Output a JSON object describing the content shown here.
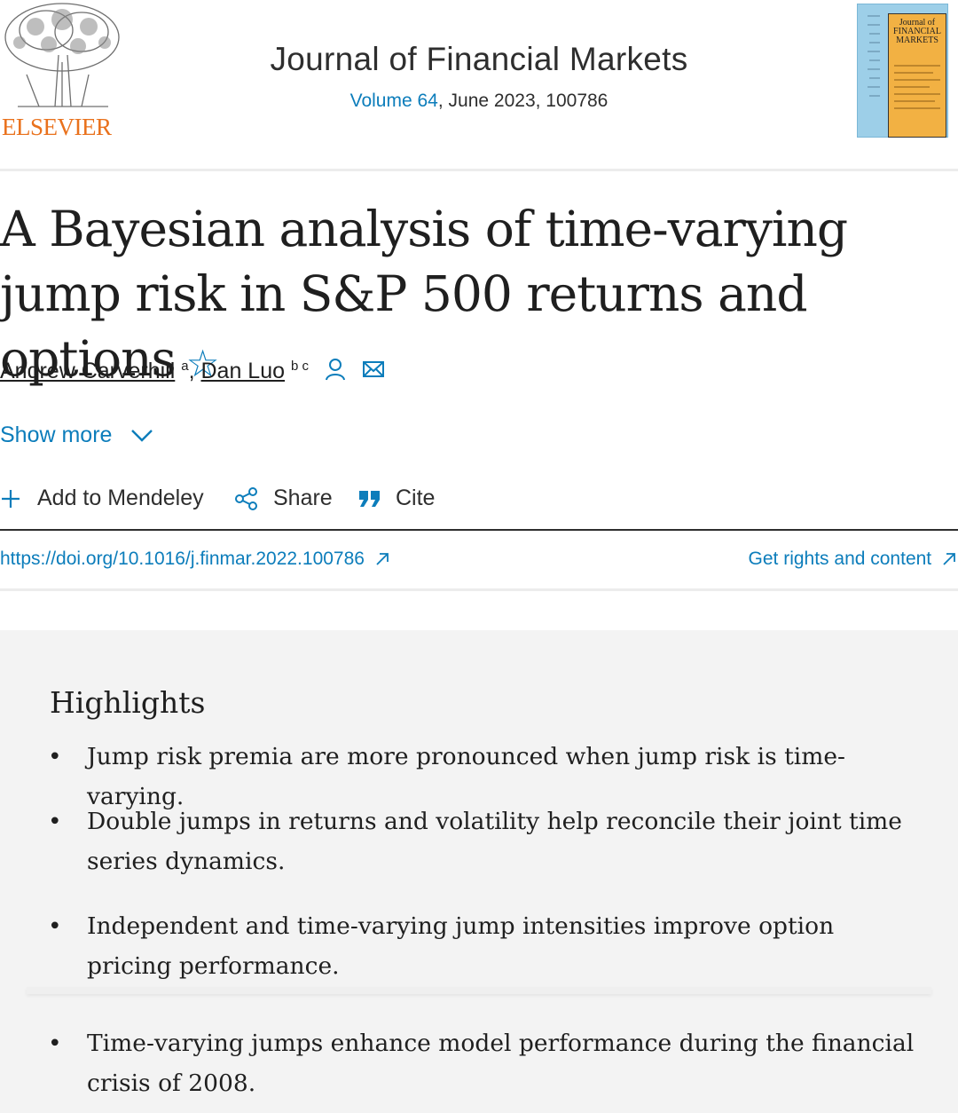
{
  "header": {
    "publisher": "ELSEVIER",
    "journal_title": "Journal of Financial Markets",
    "volume_link": "Volume 64",
    "issue_info": ", June 2023, 100786",
    "cover_title": "Journal of FINANCIAL MARKETS"
  },
  "article": {
    "title": "A Bayesian analysis of time-varying jump risk in S&P 500 returns and options",
    "authors": [
      {
        "name": "Andrew Carverhill",
        "affil": "a"
      },
      {
        "name": "Dan Luo",
        "affil": "b c"
      }
    ],
    "author_separator": ",",
    "show_more": "Show more"
  },
  "actions": {
    "mendeley": "Add to Mendeley",
    "share": "Share",
    "cite": "Cite"
  },
  "links": {
    "doi": "https://doi.org/10.1016/j.finmar.2022.100786",
    "rights": "Get rights and content"
  },
  "highlights": {
    "title": "Highlights",
    "items": [
      "Jump risk premia are more pronounced when jump risk is time-varying.",
      "Double jumps in returns and volatility help reconcile their joint time series dynamics.",
      "Independent and time-varying jump intensities improve option pricing performance.",
      "Time-varying jumps enhance model performance during the financial crisis of 2008."
    ]
  },
  "colors": {
    "link": "#0c7dbb",
    "brand": "#e9711c",
    "text": "#1f1f1f",
    "highlights_bg": "#f3f3f3"
  },
  "icons": [
    "elsevier-tree-logo",
    "star-icon",
    "person-icon",
    "mail-icon",
    "chevron-down-icon",
    "plus-icon",
    "share-icon",
    "quote-icon",
    "external-arrow-icon"
  ]
}
